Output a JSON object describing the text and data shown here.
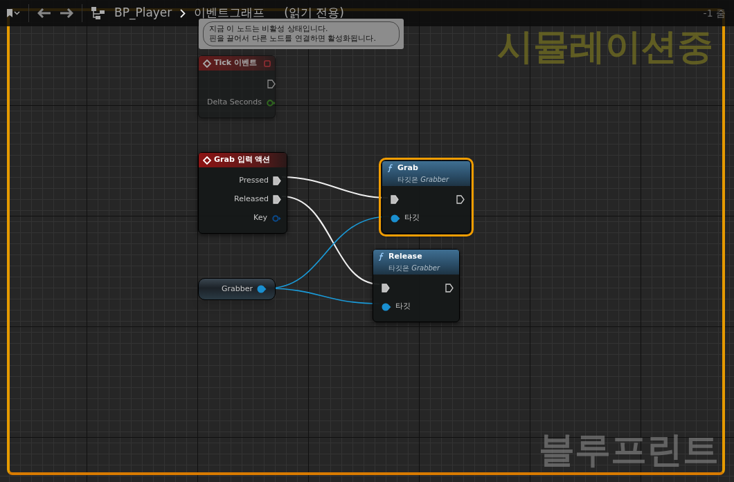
{
  "toolbar": {
    "breadcrumb": [
      "BP_Player",
      "이벤트그래프"
    ],
    "read_only": "(읽기 전용)",
    "zoom": "-1 줌"
  },
  "watermarks": {
    "status": "시뮬레이션중",
    "graph_type": "블루프린트"
  },
  "simulating": true,
  "tooltip": {
    "lines": [
      "지금 이 노드는 비활성 상태입니다.",
      "핀을 끌어서 다른 노드를 연결하면 활성화됩니다."
    ]
  },
  "nodes": [
    {
      "kind": "event",
      "title": "Tick 이벤트",
      "disabled": true,
      "selected": false,
      "outputs": [
        {
          "kind": "exec",
          "connected": false
        },
        {
          "kind": "float",
          "label": "Delta Seconds",
          "connected": false
        }
      ]
    },
    {
      "kind": "event",
      "title": "Grab 입력 액션",
      "disabled": false,
      "selected": false,
      "outputs": [
        {
          "kind": "exec",
          "label": "Pressed",
          "connected": true
        },
        {
          "kind": "exec",
          "label": "Released",
          "connected": true
        },
        {
          "kind": "struct",
          "label": "Key",
          "connected": false
        }
      ]
    },
    {
      "kind": "function",
      "title": "Grab",
      "subtitle_prefix": "타깃은",
      "subtitle_target": "Grabber",
      "disabled": false,
      "selected": true,
      "inputs": [
        {
          "kind": "exec",
          "connected": true
        },
        {
          "kind": "object",
          "label": "타깃",
          "connected": true
        }
      ],
      "outputs": [
        {
          "kind": "exec",
          "connected": false
        }
      ]
    },
    {
      "kind": "function",
      "title": "Release",
      "subtitle_prefix": "타깃은",
      "subtitle_target": "Grabber",
      "disabled": false,
      "selected": false,
      "inputs": [
        {
          "kind": "exec",
          "connected": true
        },
        {
          "kind": "object",
          "label": "타깃",
          "connected": true
        }
      ],
      "outputs": [
        {
          "kind": "exec",
          "connected": false
        }
      ]
    },
    {
      "kind": "variable",
      "title": "Grabber",
      "disabled": false,
      "selected": false,
      "outputs": [
        {
          "kind": "object",
          "connected": true
        }
      ]
    }
  ]
}
